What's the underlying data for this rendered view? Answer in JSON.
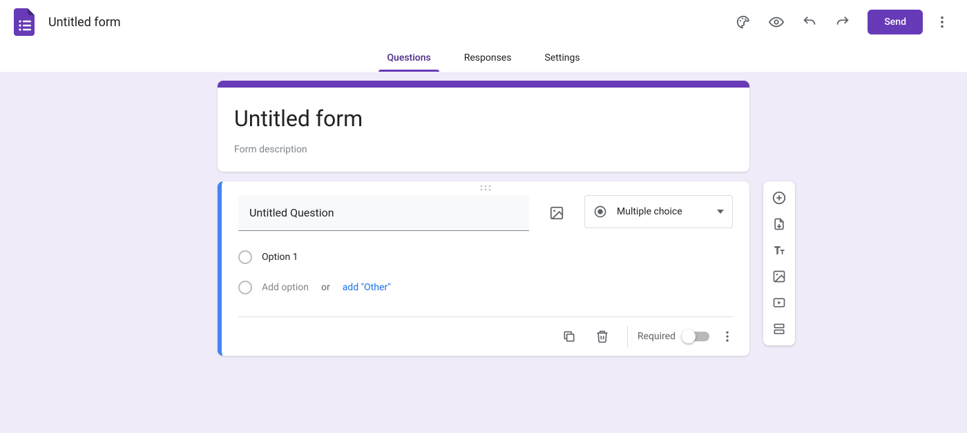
{
  "header": {
    "doc_title": "Untitled form",
    "send_label": "Send"
  },
  "tabs": {
    "questions": "Questions",
    "responses": "Responses",
    "settings": "Settings"
  },
  "form": {
    "title": "Untitled form",
    "description_placeholder": "Form description"
  },
  "question": {
    "title": "Untitled Question",
    "type_label": "Multiple choice",
    "option1": "Option 1",
    "add_option": "Add option",
    "or": "or",
    "add_other": "add \"Other\"",
    "required_label": "Required"
  }
}
